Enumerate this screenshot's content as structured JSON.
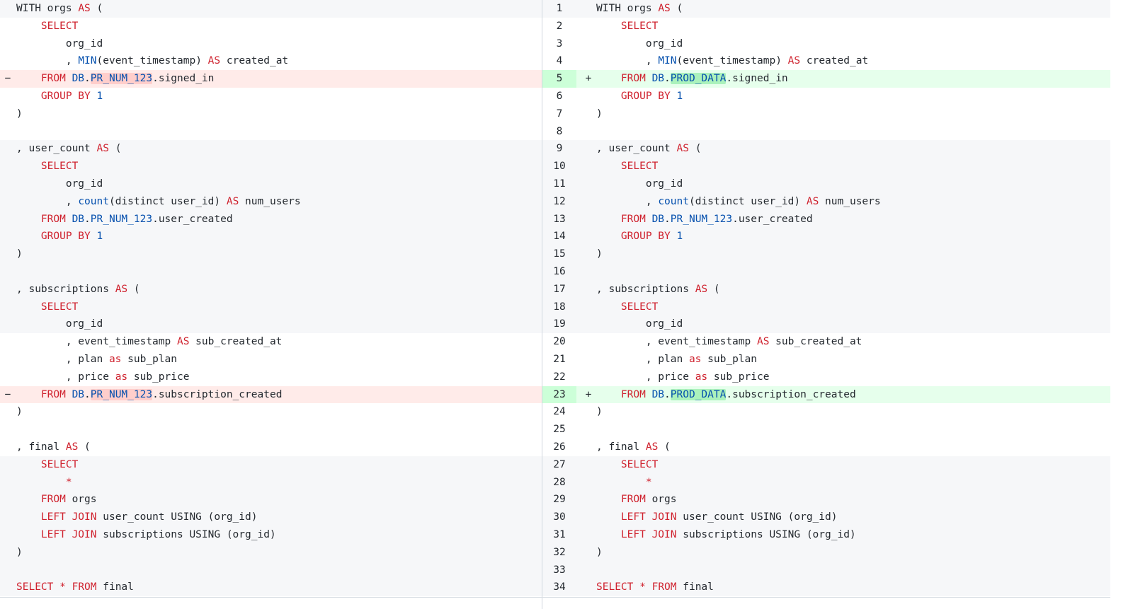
{
  "diff": {
    "left": [
      {
        "bg": "gray",
        "marker": "",
        "tokens": [
          [
            "",
            "WITH orgs "
          ],
          [
            "kw",
            "AS"
          ],
          [
            "",
            " ("
          ]
        ]
      },
      {
        "bg": "white",
        "marker": "",
        "tokens": [
          [
            "",
            "    "
          ],
          [
            "kw",
            "SELECT"
          ]
        ]
      },
      {
        "bg": "white",
        "marker": "",
        "tokens": [
          [
            "",
            "        org_id"
          ]
        ]
      },
      {
        "bg": "white",
        "marker": "",
        "tokens": [
          [
            "",
            "        , "
          ],
          [
            "fn",
            "MIN"
          ],
          [
            "",
            "(event_timestamp) "
          ],
          [
            "kw",
            "AS"
          ],
          [
            "",
            " created_at"
          ]
        ]
      },
      {
        "bg": "del",
        "marker": "−",
        "tokens": [
          [
            "",
            "    "
          ],
          [
            "kw",
            "FROM"
          ],
          [
            "",
            " "
          ],
          [
            "fn",
            "DB"
          ],
          [
            "",
            "."
          ],
          [
            "hldel",
            "PR_NUM_123"
          ],
          [
            "",
            ".signed_in"
          ]
        ]
      },
      {
        "bg": "white",
        "marker": "",
        "tokens": [
          [
            "",
            "    "
          ],
          [
            "kw",
            "GROUP BY"
          ],
          [
            "",
            " "
          ],
          [
            "num",
            "1"
          ]
        ]
      },
      {
        "bg": "white",
        "marker": "",
        "tokens": [
          [
            "",
            ")"
          ]
        ]
      },
      {
        "bg": "white",
        "marker": "",
        "tokens": [
          [
            "",
            ""
          ]
        ]
      },
      {
        "bg": "gray",
        "marker": "",
        "tokens": [
          [
            "",
            ", user_count "
          ],
          [
            "kw",
            "AS"
          ],
          [
            "",
            " ("
          ]
        ]
      },
      {
        "bg": "gray",
        "marker": "",
        "tokens": [
          [
            "",
            "    "
          ],
          [
            "kw",
            "SELECT"
          ]
        ]
      },
      {
        "bg": "gray",
        "marker": "",
        "tokens": [
          [
            "",
            "        org_id"
          ]
        ]
      },
      {
        "bg": "gray",
        "marker": "",
        "tokens": [
          [
            "",
            "        , "
          ],
          [
            "fn",
            "count"
          ],
          [
            "",
            "(distinct user_id) "
          ],
          [
            "kw",
            "AS"
          ],
          [
            "",
            " num_users"
          ]
        ]
      },
      {
        "bg": "gray",
        "marker": "",
        "tokens": [
          [
            "",
            "    "
          ],
          [
            "kw",
            "FROM"
          ],
          [
            "",
            " "
          ],
          [
            "fn",
            "DB"
          ],
          [
            "",
            "."
          ],
          [
            "fn",
            "PR_NUM_123"
          ],
          [
            "",
            ".user_created"
          ]
        ]
      },
      {
        "bg": "gray",
        "marker": "",
        "tokens": [
          [
            "",
            "    "
          ],
          [
            "kw",
            "GROUP BY"
          ],
          [
            "",
            " "
          ],
          [
            "num",
            "1"
          ]
        ]
      },
      {
        "bg": "gray",
        "marker": "",
        "tokens": [
          [
            "",
            ")"
          ]
        ]
      },
      {
        "bg": "gray",
        "marker": "",
        "tokens": [
          [
            "",
            ""
          ]
        ]
      },
      {
        "bg": "gray",
        "marker": "",
        "tokens": [
          [
            "",
            ", subscriptions "
          ],
          [
            "kw",
            "AS"
          ],
          [
            "",
            " ("
          ]
        ]
      },
      {
        "bg": "gray",
        "marker": "",
        "tokens": [
          [
            "",
            "    "
          ],
          [
            "kw",
            "SELECT"
          ]
        ]
      },
      {
        "bg": "gray",
        "marker": "",
        "tokens": [
          [
            "",
            "        org_id"
          ]
        ]
      },
      {
        "bg": "white",
        "marker": "",
        "tokens": [
          [
            "",
            "        , event_timestamp "
          ],
          [
            "kw",
            "AS"
          ],
          [
            "",
            " sub_created_at"
          ]
        ]
      },
      {
        "bg": "white",
        "marker": "",
        "tokens": [
          [
            "",
            "        , plan "
          ],
          [
            "kw",
            "as"
          ],
          [
            "",
            " sub_plan"
          ]
        ]
      },
      {
        "bg": "white",
        "marker": "",
        "tokens": [
          [
            "",
            "        , price "
          ],
          [
            "kw",
            "as"
          ],
          [
            "",
            " sub_price"
          ]
        ]
      },
      {
        "bg": "del",
        "marker": "−",
        "tokens": [
          [
            "",
            "    "
          ],
          [
            "kw",
            "FROM"
          ],
          [
            "",
            " "
          ],
          [
            "fn",
            "DB"
          ],
          [
            "",
            "."
          ],
          [
            "hldel",
            "PR_NUM_123"
          ],
          [
            "",
            ".subscription_created"
          ]
        ]
      },
      {
        "bg": "white",
        "marker": "",
        "tokens": [
          [
            "",
            ")"
          ]
        ]
      },
      {
        "bg": "white",
        "marker": "",
        "tokens": [
          [
            "",
            ""
          ]
        ]
      },
      {
        "bg": "white",
        "marker": "",
        "tokens": [
          [
            "",
            ", final "
          ],
          [
            "kw",
            "AS"
          ],
          [
            "",
            " ("
          ]
        ]
      },
      {
        "bg": "gray",
        "marker": "",
        "tokens": [
          [
            "",
            "    "
          ],
          [
            "kw",
            "SELECT"
          ]
        ]
      },
      {
        "bg": "gray",
        "marker": "",
        "tokens": [
          [
            "",
            "        "
          ],
          [
            "kw",
            "*"
          ]
        ]
      },
      {
        "bg": "gray",
        "marker": "",
        "tokens": [
          [
            "",
            "    "
          ],
          [
            "kw",
            "FROM"
          ],
          [
            "",
            " orgs"
          ]
        ]
      },
      {
        "bg": "gray",
        "marker": "",
        "tokens": [
          [
            "",
            "    "
          ],
          [
            "kw",
            "LEFT JOIN"
          ],
          [
            "",
            " user_count USING (org_id)"
          ]
        ]
      },
      {
        "bg": "gray",
        "marker": "",
        "tokens": [
          [
            "",
            "    "
          ],
          [
            "kw",
            "LEFT JOIN"
          ],
          [
            "",
            " subscriptions USING (org_id)"
          ]
        ]
      },
      {
        "bg": "gray",
        "marker": "",
        "tokens": [
          [
            "",
            ")"
          ]
        ]
      },
      {
        "bg": "gray",
        "marker": "",
        "tokens": [
          [
            "",
            ""
          ]
        ]
      },
      {
        "bg": "gray",
        "marker": "",
        "tokens": [
          [
            "kw",
            "SELECT"
          ],
          [
            "",
            " "
          ],
          [
            "kw",
            "*"
          ],
          [
            "",
            " "
          ],
          [
            "kw",
            "FROM"
          ],
          [
            "",
            " final"
          ]
        ]
      }
    ],
    "right": [
      {
        "num": "1",
        "bg": "gray",
        "marker": "",
        "tokens": [
          [
            "",
            "WITH orgs "
          ],
          [
            "kw",
            "AS"
          ],
          [
            "",
            " ("
          ]
        ]
      },
      {
        "num": "2",
        "bg": "white",
        "marker": "",
        "tokens": [
          [
            "",
            "    "
          ],
          [
            "kw",
            "SELECT"
          ]
        ]
      },
      {
        "num": "3",
        "bg": "white",
        "marker": "",
        "tokens": [
          [
            "",
            "        org_id"
          ]
        ]
      },
      {
        "num": "4",
        "bg": "white",
        "marker": "",
        "tokens": [
          [
            "",
            "        , "
          ],
          [
            "fn",
            "MIN"
          ],
          [
            "",
            "(event_timestamp) "
          ],
          [
            "kw",
            "AS"
          ],
          [
            "",
            " created_at"
          ]
        ]
      },
      {
        "num": "5",
        "bg": "add",
        "marker": "+",
        "tokens": [
          [
            "",
            "    "
          ],
          [
            "kw",
            "FROM"
          ],
          [
            "",
            " "
          ],
          [
            "fn",
            "DB"
          ],
          [
            "",
            "."
          ],
          [
            "hladd",
            "PROD_DATA"
          ],
          [
            "",
            ".signed_in"
          ]
        ]
      },
      {
        "num": "6",
        "bg": "white",
        "marker": "",
        "tokens": [
          [
            "",
            "    "
          ],
          [
            "kw",
            "GROUP BY"
          ],
          [
            "",
            " "
          ],
          [
            "num",
            "1"
          ]
        ]
      },
      {
        "num": "7",
        "bg": "white",
        "marker": "",
        "tokens": [
          [
            "",
            ")"
          ]
        ]
      },
      {
        "num": "8",
        "bg": "white",
        "marker": "",
        "tokens": [
          [
            "",
            ""
          ]
        ]
      },
      {
        "num": "9",
        "bg": "gray",
        "marker": "",
        "tokens": [
          [
            "",
            ", user_count "
          ],
          [
            "kw",
            "AS"
          ],
          [
            "",
            " ("
          ]
        ]
      },
      {
        "num": "10",
        "bg": "gray",
        "marker": "",
        "tokens": [
          [
            "",
            "    "
          ],
          [
            "kw",
            "SELECT"
          ]
        ]
      },
      {
        "num": "11",
        "bg": "gray",
        "marker": "",
        "tokens": [
          [
            "",
            "        org_id"
          ]
        ]
      },
      {
        "num": "12",
        "bg": "gray",
        "marker": "",
        "tokens": [
          [
            "",
            "        , "
          ],
          [
            "fn",
            "count"
          ],
          [
            "",
            "(distinct user_id) "
          ],
          [
            "kw",
            "AS"
          ],
          [
            "",
            " num_users"
          ]
        ]
      },
      {
        "num": "13",
        "bg": "gray",
        "marker": "",
        "tokens": [
          [
            "",
            "    "
          ],
          [
            "kw",
            "FROM"
          ],
          [
            "",
            " "
          ],
          [
            "fn",
            "DB"
          ],
          [
            "",
            "."
          ],
          [
            "fn",
            "PR_NUM_123"
          ],
          [
            "",
            ".user_created"
          ]
        ]
      },
      {
        "num": "14",
        "bg": "gray",
        "marker": "",
        "tokens": [
          [
            "",
            "    "
          ],
          [
            "kw",
            "GROUP BY"
          ],
          [
            "",
            " "
          ],
          [
            "num",
            "1"
          ]
        ]
      },
      {
        "num": "15",
        "bg": "gray",
        "marker": "",
        "tokens": [
          [
            "",
            ")"
          ]
        ]
      },
      {
        "num": "16",
        "bg": "gray",
        "marker": "",
        "tokens": [
          [
            "",
            ""
          ]
        ]
      },
      {
        "num": "17",
        "bg": "gray",
        "marker": "",
        "tokens": [
          [
            "",
            ", subscriptions "
          ],
          [
            "kw",
            "AS"
          ],
          [
            "",
            " ("
          ]
        ]
      },
      {
        "num": "18",
        "bg": "gray",
        "marker": "",
        "tokens": [
          [
            "",
            "    "
          ],
          [
            "kw",
            "SELECT"
          ]
        ]
      },
      {
        "num": "19",
        "bg": "gray",
        "marker": "",
        "tokens": [
          [
            "",
            "        org_id"
          ]
        ]
      },
      {
        "num": "20",
        "bg": "white",
        "marker": "",
        "tokens": [
          [
            "",
            "        , event_timestamp "
          ],
          [
            "kw",
            "AS"
          ],
          [
            "",
            " sub_created_at"
          ]
        ]
      },
      {
        "num": "21",
        "bg": "white",
        "marker": "",
        "tokens": [
          [
            "",
            "        , plan "
          ],
          [
            "kw",
            "as"
          ],
          [
            "",
            " sub_plan"
          ]
        ]
      },
      {
        "num": "22",
        "bg": "white",
        "marker": "",
        "tokens": [
          [
            "",
            "        , price "
          ],
          [
            "kw",
            "as"
          ],
          [
            "",
            " sub_price"
          ]
        ]
      },
      {
        "num": "23",
        "bg": "add",
        "marker": "+",
        "tokens": [
          [
            "",
            "    "
          ],
          [
            "kw",
            "FROM"
          ],
          [
            "",
            " "
          ],
          [
            "fn",
            "DB"
          ],
          [
            "",
            "."
          ],
          [
            "hladd",
            "PROD_DATA"
          ],
          [
            "",
            ".subscription_created"
          ]
        ]
      },
      {
        "num": "24",
        "bg": "white",
        "marker": "",
        "tokens": [
          [
            "",
            ")"
          ]
        ]
      },
      {
        "num": "25",
        "bg": "white",
        "marker": "",
        "tokens": [
          [
            "",
            ""
          ]
        ]
      },
      {
        "num": "26",
        "bg": "white",
        "marker": "",
        "tokens": [
          [
            "",
            ", final "
          ],
          [
            "kw",
            "AS"
          ],
          [
            "",
            " ("
          ]
        ]
      },
      {
        "num": "27",
        "bg": "gray",
        "marker": "",
        "tokens": [
          [
            "",
            "    "
          ],
          [
            "kw",
            "SELECT"
          ]
        ]
      },
      {
        "num": "28",
        "bg": "gray",
        "marker": "",
        "tokens": [
          [
            "",
            "        "
          ],
          [
            "kw",
            "*"
          ]
        ]
      },
      {
        "num": "29",
        "bg": "gray",
        "marker": "",
        "tokens": [
          [
            "",
            "    "
          ],
          [
            "kw",
            "FROM"
          ],
          [
            "",
            " orgs"
          ]
        ]
      },
      {
        "num": "30",
        "bg": "gray",
        "marker": "",
        "tokens": [
          [
            "",
            "    "
          ],
          [
            "kw",
            "LEFT JOIN"
          ],
          [
            "",
            " user_count USING (org_id)"
          ]
        ]
      },
      {
        "num": "31",
        "bg": "gray",
        "marker": "",
        "tokens": [
          [
            "",
            "    "
          ],
          [
            "kw",
            "LEFT JOIN"
          ],
          [
            "",
            " subscriptions USING (org_id)"
          ]
        ]
      },
      {
        "num": "32",
        "bg": "gray",
        "marker": "",
        "tokens": [
          [
            "",
            ")"
          ]
        ]
      },
      {
        "num": "33",
        "bg": "gray",
        "marker": "",
        "tokens": [
          [
            "",
            ""
          ]
        ]
      },
      {
        "num": "34",
        "bg": "gray",
        "marker": "",
        "tokens": [
          [
            "kw",
            "SELECT"
          ],
          [
            "",
            " "
          ],
          [
            "kw",
            "*"
          ],
          [
            "",
            " "
          ],
          [
            "kw",
            "FROM"
          ],
          [
            "",
            " final"
          ]
        ]
      }
    ]
  },
  "colors": {
    "keyword": "#cf222e",
    "identifier": "#0550ae",
    "deleted_line": "#ffebe9",
    "deleted_highlight": "#ffcecb",
    "added_line": "#e6ffec",
    "added_highlight": "#abf2bc"
  }
}
